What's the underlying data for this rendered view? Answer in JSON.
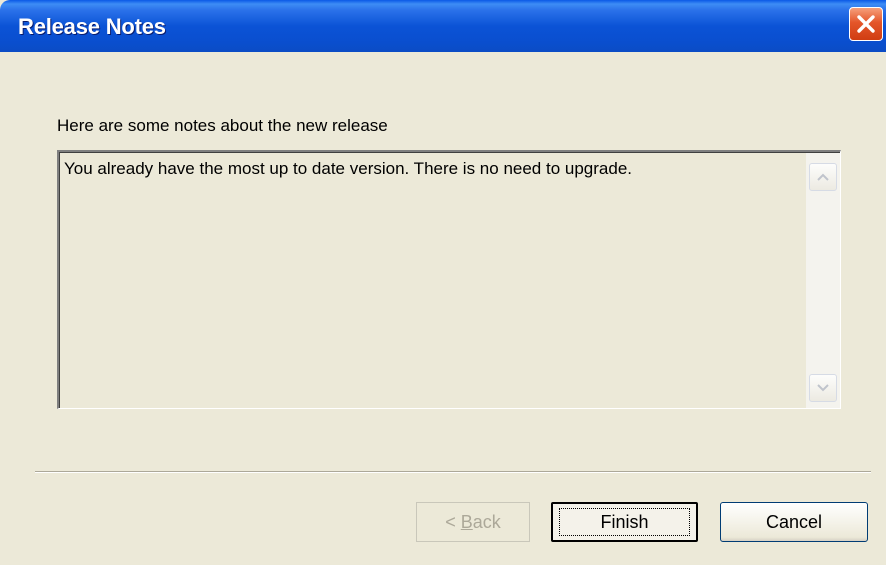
{
  "window": {
    "title": "Release Notes"
  },
  "content": {
    "prompt": "Here are some notes about the new release",
    "notes_text": "You already have the most up to date version.  There is no need to upgrade."
  },
  "buttons": {
    "back_prefix": "< ",
    "back_mnemonic": "B",
    "back_rest": "ack",
    "finish_label": "Finish",
    "cancel_label": "Cancel"
  },
  "colors": {
    "titlebar": "#0b53d6",
    "dialog_bg": "#ece9d8",
    "close_button": "#e4562a"
  },
  "icons": {
    "close": "close-icon",
    "scroll_up": "scroll-up-arrow-icon",
    "scroll_down": "scroll-down-arrow-icon"
  }
}
